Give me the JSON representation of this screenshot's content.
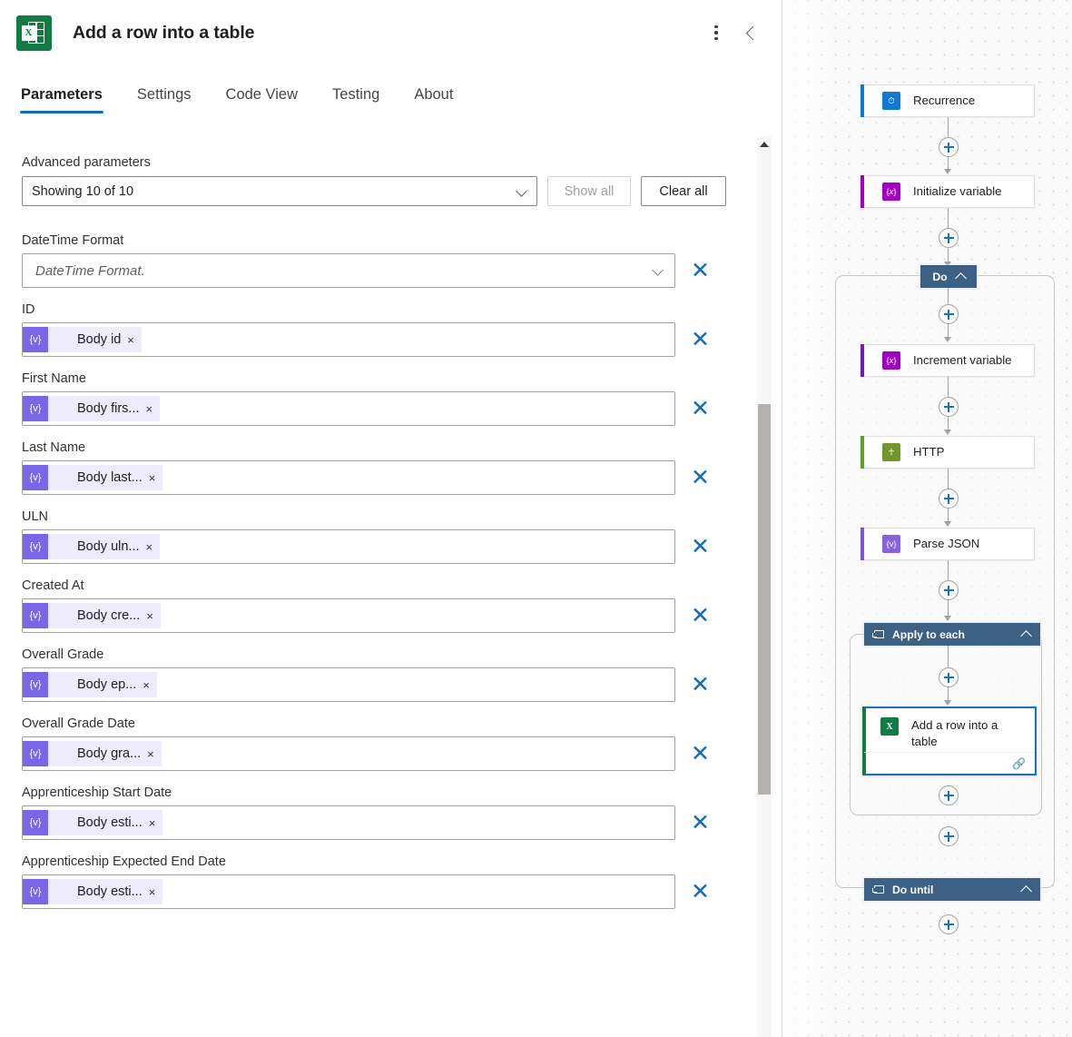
{
  "panel": {
    "app_icon": "excel-icon",
    "title": "Add a row into a table",
    "menu_icon": "more-vertical-icon",
    "collapse_icon": "chevron-left-icon",
    "tabs": [
      {
        "label": "Parameters",
        "active": true
      },
      {
        "label": "Settings",
        "active": false
      },
      {
        "label": "Code View",
        "active": false
      },
      {
        "label": "Testing",
        "active": false
      },
      {
        "label": "About",
        "active": false
      }
    ],
    "advanced": {
      "label": "Advanced parameters",
      "dropdown_value": "Showing 10 of 10",
      "show_all_label": "Show all",
      "clear_all_label": "Clear all"
    },
    "fields": [
      {
        "label": "DateTime Format",
        "type": "dropdown",
        "placeholder": "DateTime Format.",
        "clear_icon": "clear-icon"
      },
      {
        "label": "ID",
        "type": "token",
        "token": "Body id",
        "token_icon": "dynamic-content-icon",
        "token_remove": "×",
        "clear_icon": "clear-icon"
      },
      {
        "label": "First Name",
        "type": "token",
        "token": "Body firs...",
        "token_icon": "dynamic-content-icon",
        "token_remove": "×",
        "clear_icon": "clear-icon"
      },
      {
        "label": "Last Name",
        "type": "token",
        "token": "Body last...",
        "token_icon": "dynamic-content-icon",
        "token_remove": "×",
        "clear_icon": "clear-icon"
      },
      {
        "label": "ULN",
        "type": "token",
        "token": "Body uln...",
        "token_icon": "dynamic-content-icon",
        "token_remove": "×",
        "clear_icon": "clear-icon"
      },
      {
        "label": "Created At",
        "type": "token",
        "token": "Body cre...",
        "token_icon": "dynamic-content-icon",
        "token_remove": "×",
        "clear_icon": "clear-icon"
      },
      {
        "label": "Overall Grade",
        "type": "token",
        "token": "Body ep...",
        "token_icon": "dynamic-content-icon",
        "token_remove": "×",
        "clear_icon": "clear-icon"
      },
      {
        "label": "Overall Grade Date",
        "type": "token",
        "token": "Body gra...",
        "token_icon": "dynamic-content-icon",
        "token_remove": "×",
        "clear_icon": "clear-icon"
      },
      {
        "label": "Apprenticeship Start Date",
        "type": "token",
        "token": "Body esti...",
        "token_icon": "dynamic-content-icon",
        "token_remove": "×",
        "clear_icon": "clear-icon"
      },
      {
        "label": "Apprenticeship Expected End Date",
        "type": "token",
        "token": "Body esti...",
        "token_icon": "dynamic-content-icon",
        "token_remove": "×",
        "clear_icon": "clear-icon"
      }
    ],
    "scrollbar": {
      "up_arrow_icon": "scroll-up-arrow-icon",
      "thumb": "scroll-thumb"
    }
  },
  "canvas": {
    "nodes": [
      {
        "label": "Recurrence",
        "icon_glyph": "⏱",
        "icon_color": "#0f7bd6",
        "accent": "#0f7bd6",
        "selected": false
      },
      {
        "label": "Initialize variable",
        "icon_glyph": "{x}",
        "icon_color": "#a100c2",
        "accent": "#a100c2",
        "selected": false
      },
      {
        "label": "Increment variable",
        "icon_glyph": "{x}",
        "icon_color": "#a100c2",
        "accent": "#7719aa",
        "selected": false
      },
      {
        "label": "HTTP",
        "icon_glyph": "⚘",
        "icon_color": "#709727",
        "accent": "#5fa02a",
        "selected": false
      },
      {
        "label": "Parse JSON",
        "icon_glyph": "{v}",
        "icon_color": "#8662e0",
        "accent": "#7b55d8",
        "selected": false
      },
      {
        "label": "Add a row into a table",
        "icon_glyph": "X",
        "icon_color": "#107c41",
        "accent": "#107c41",
        "selected": true,
        "link_icon": "link-icon"
      }
    ],
    "scopes": [
      {
        "label": "Do",
        "collapse_icon": "chevron-up-icon",
        "scope_icon": "loop-icon"
      },
      {
        "label": "Apply to each",
        "collapse_icon": "chevron-up-icon",
        "scope_icon": "loop-icon"
      },
      {
        "label": "Do until",
        "collapse_icon": "chevron-up-icon",
        "scope_icon": "loop-icon"
      }
    ],
    "add_step_icon": "plus-icon"
  }
}
